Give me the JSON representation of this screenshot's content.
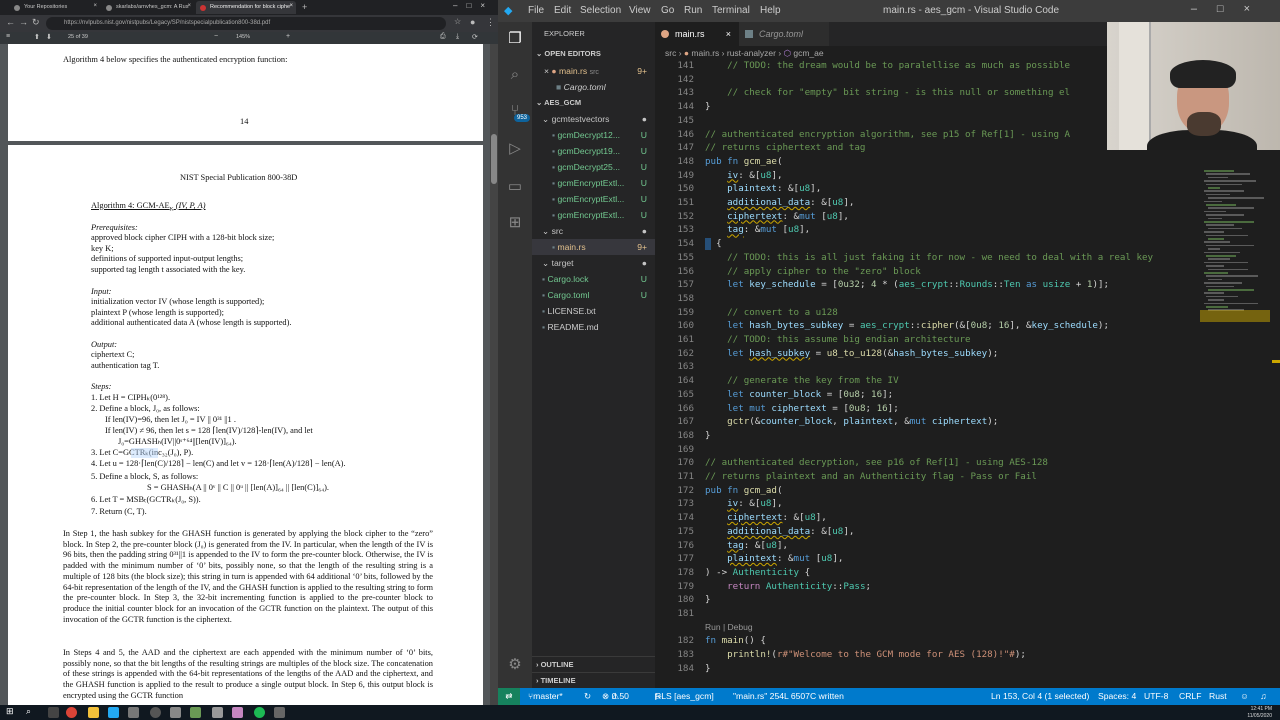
{
  "browser": {
    "tabs": [
      {
        "label": "Your Repositories",
        "active": false
      },
      {
        "label": "skarlabs/arnvhes_gcm: A Rus",
        "active": false
      },
      {
        "label": "Recommendation for block ciphe",
        "active": true
      }
    ],
    "url_host": "nvlpubs.nist.gov",
    "url": "https://nvlpubs.nist.gov/nistpubs/Legacy/SP/nistspecialpublication800-38d.pdf",
    "page_indicator": "25 of 39",
    "zoom": "145%"
  },
  "pdf": {
    "page1_text": "Algorithm 4 below specifies the authenticated encryption function:",
    "page1_number": "14",
    "header": "NIST Special Publication 800-38D",
    "algo_title": "Algorithm 4:  GCM-AE",
    "algo_sub": "K",
    "algo_args": "(IV, P, A)",
    "prereq_label": "Prerequisites:",
    "prereqs": [
      "approved block cipher CIPH with a 128-bit block size;",
      "key K;",
      "definitions of supported input-output lengths;",
      "supported tag length t associated with the key."
    ],
    "input_label": "Input:",
    "inputs": [
      "initialization vector IV (whose length is supported);",
      "plaintext P (whose length is supported);",
      "additional authenticated data A (whose length is supported)."
    ],
    "output_label": "Output:",
    "outputs": [
      "ciphertext C;",
      "authentication tag T."
    ],
    "steps_label": "Steps:",
    "steps": [
      "1.  Let H = CIPHₖ(0¹²⁸).",
      "2.  Define a block, J₀, as follows:",
      "If len(IV)=96, then let J₀ = IV || 0³¹ ||1 .",
      "If len(IV) ≠ 96, then let s = 128 ⌈len(IV)/128⌉-len(IV), and let",
      "J₀=GHASHₕ(IV||0ˢ⁺⁶⁴||[len(IV)]₆₄).",
      "3.  Let C=GCTRₖ(inc₃₂(J₀), P).",
      "4.  Let u = 128·⌈len(C)/128⌉ − len(C) and let v = 128·⌈len(A)/128⌉ − len(A).",
      "5.  Define a block, S, as follows:",
      "S = GHASHₕ(A || 0ᵛ || C || 0ᵘ || [len(A)]₆₄ || [len(C)]₆₄).",
      "6.  Let T = MSBₜ(GCTRₖ(J₀, S)).",
      "7.  Return (C, T)."
    ],
    "para1": "In Step 1, the hash subkey for the GHASH function is generated by applying the block cipher to the “zero” block. In Step 2, the pre-counter block (J₀) is generated from the IV. In particular, when the length of the IV is 96 bits, then the padding string 0³¹||1 is appended to the IV to form the pre-counter block. Otherwise, the IV is padded with the minimum number of ‘0’ bits, possibly none, so that the length of the resulting string is a multiple of 128 bits (the block size); this string in turn is appended with 64 additional ‘0’ bits, followed by the 64-bit representation of the length of the IV, and the GHASH function is applied to the resulting string to form the pre-counter block. In Step 3, the 32-bit incrementing function is applied to the pre-counter block to produce the initial counter block for an invocation of the GCTR function on the plaintext. The output of this invocation of the GCTR function is the ciphertext.",
    "para2": "In Steps 4 and 5, the AAD and the ciphertext are each appended with the minimum number of ‘0’ bits, possibly none, so that the bit lengths of the resulting strings are multiples of the block size. The concatenation of these strings is appended with the 64-bit representations of the lengths of the AAD and the ciphertext, and the GHASH function is applied to the result to produce a single output block. In Step 6, this output block is encrypted using the GCTR function"
  },
  "vscode": {
    "menu": [
      "File",
      "Edit",
      "Selection",
      "View",
      "Go",
      "Run",
      "Terminal",
      "Help"
    ],
    "window_title": "main.rs - aes_gcm - Visual Studio Code",
    "explorer_label": "EXPLORER",
    "open_editors_label": "OPEN EDITORS",
    "open_editors": [
      {
        "name": "main.rs",
        "path": "src",
        "badge": "9+"
      },
      {
        "name": "Cargo.toml",
        "path": "",
        "badge": ""
      }
    ],
    "project_label": "AES_GCM",
    "tree": [
      {
        "name": "gcmtestvectors",
        "badge": "●",
        "indent": 1,
        "folder": true
      },
      {
        "name": "gcmDecrypt12...",
        "badge": "U",
        "indent": 2
      },
      {
        "name": "gcmDecrypt19...",
        "badge": "U",
        "indent": 2
      },
      {
        "name": "gcmDecrypt25...",
        "badge": "U",
        "indent": 2
      },
      {
        "name": "gcmEncryptExtl...",
        "badge": "U",
        "indent": 2
      },
      {
        "name": "gcmEncryptExtl...",
        "badge": "U",
        "indent": 2
      },
      {
        "name": "gcmEncryptExtl...",
        "badge": "U",
        "indent": 2
      },
      {
        "name": "src",
        "badge": "●",
        "indent": 1,
        "folder": true
      },
      {
        "name": "main.rs",
        "badge": "9+",
        "indent": 2,
        "selected": true
      },
      {
        "name": "target",
        "badge": "●",
        "indent": 1,
        "folder": true
      },
      {
        "name": "Cargo.lock",
        "badge": "U",
        "indent": 1
      },
      {
        "name": "Cargo.toml",
        "badge": "U",
        "indent": 1
      },
      {
        "name": "LICENSE.txt",
        "badge": "",
        "indent": 1
      },
      {
        "name": "README.md",
        "badge": "",
        "indent": 1
      }
    ],
    "outline_label": "OUTLINE",
    "timeline_label": "TIMELINE",
    "tabs": [
      {
        "name": "main.rs",
        "active": true,
        "close": "×"
      },
      {
        "name": "Cargo.toml",
        "active": false,
        "close": ""
      }
    ],
    "breadcrumb": [
      "src",
      "main.rs",
      "rust-analyzer",
      "gcm_ae"
    ],
    "status": {
      "branch": "master*",
      "errors": "0",
      "warnings": "50",
      "rls": "RLS [aes_gcm]",
      "message": "\"main.rs\" 254L 6507C written",
      "position": "Ln 153, Col 4 (1 selected)",
      "spaces": "Spaces: 4",
      "encoding": "UTF-8",
      "eol": "CRLF",
      "language": "Rust"
    },
    "activity_badge": "953"
  },
  "code_lines": [
    {
      "n": "141",
      "h": [
        [
          "    ",
          "t"
        ],
        [
          "// TODO: the dream would be to paralellise as much as possible",
          "c-com"
        ]
      ]
    },
    {
      "n": "142",
      "h": [
        [
          "",
          "t"
        ]
      ]
    },
    {
      "n": "143",
      "h": [
        [
          "    ",
          "t"
        ],
        [
          "// check for \"empty\" bit string - is this null or something el",
          "c-com"
        ]
      ]
    },
    {
      "n": "144",
      "h": [
        [
          "}",
          "t"
        ]
      ]
    },
    {
      "n": "145",
      "h": [
        [
          "",
          "t"
        ]
      ]
    },
    {
      "n": "146",
      "h": [
        [
          "// authenticated encryption algorithm, see p15 of Ref[1] - using A",
          "c-com"
        ]
      ]
    },
    {
      "n": "147",
      "h": [
        [
          "// returns ciphertext and tag",
          "c-com"
        ]
      ]
    },
    {
      "n": "148",
      "h": [
        [
          "pub fn ",
          "c-kw"
        ],
        [
          "gcm_ae",
          "c-fn"
        ],
        [
          "(",
          "t"
        ]
      ]
    },
    {
      "n": "149",
      "h": [
        [
          "    ",
          "t"
        ],
        [
          "iv",
          "c-var c-warn"
        ],
        [
          ": &[",
          "t"
        ],
        [
          "u8",
          "c-ty"
        ],
        [
          "],",
          "t"
        ]
      ]
    },
    {
      "n": "150",
      "h": [
        [
          "    ",
          "t"
        ],
        [
          "plaintext",
          "c-var"
        ],
        [
          ": &[",
          "t"
        ],
        [
          "u8",
          "c-ty"
        ],
        [
          "],",
          "t"
        ]
      ]
    },
    {
      "n": "151",
      "h": [
        [
          "    ",
          "t"
        ],
        [
          "additional_data",
          "c-var c-warn"
        ],
        [
          ": &[",
          "t"
        ],
        [
          "u8",
          "c-ty"
        ],
        [
          "],",
          "t"
        ]
      ]
    },
    {
      "n": "152",
      "h": [
        [
          "    ",
          "t"
        ],
        [
          "ciphertext",
          "c-var c-warn"
        ],
        [
          ": &",
          "t"
        ],
        [
          "mut",
          "c-kw"
        ],
        [
          " [",
          "t"
        ],
        [
          "u8",
          "c-ty"
        ],
        [
          "],",
          "t"
        ]
      ]
    },
    {
      "n": "153",
      "h": [
        [
          "    ",
          "t"
        ],
        [
          "tag",
          "c-var c-warn"
        ],
        [
          ": &",
          "t"
        ],
        [
          "mut",
          "c-kw"
        ],
        [
          " [",
          "t"
        ],
        [
          "u8",
          "c-ty"
        ],
        [
          "],",
          "t"
        ]
      ]
    },
    {
      "n": "154",
      "h": [
        [
          ") {",
          "t"
        ]
      ]
    },
    {
      "n": "155",
      "h": [
        [
          "    ",
          "t"
        ],
        [
          "// TODO: this is all just faking it for now - we need to deal with a real key",
          "c-com"
        ]
      ]
    },
    {
      "n": "156",
      "h": [
        [
          "    ",
          "t"
        ],
        [
          "// apply cipher to the \"zero\" block",
          "c-com"
        ]
      ]
    },
    {
      "n": "157",
      "h": [
        [
          "    ",
          "t"
        ],
        [
          "let ",
          "c-kw"
        ],
        [
          "key_schedule",
          "c-var"
        ],
        [
          " = [",
          "t"
        ],
        [
          "0u32",
          "c-num"
        ],
        [
          "; ",
          "t"
        ],
        [
          "4",
          "c-num"
        ],
        [
          " * (",
          "t"
        ],
        [
          "aes_crypt",
          "c-ty"
        ],
        [
          "::",
          "t"
        ],
        [
          "Rounds",
          "c-ty"
        ],
        [
          "::",
          "t"
        ],
        [
          "Ten",
          "c-ty"
        ],
        [
          " as ",
          "c-kw"
        ],
        [
          "usize",
          "c-ty"
        ],
        [
          " + ",
          "t"
        ],
        [
          "1",
          "c-num"
        ],
        [
          ")];",
          "t"
        ]
      ]
    },
    {
      "n": "158",
      "h": [
        [
          "",
          "t"
        ]
      ]
    },
    {
      "n": "159",
      "h": [
        [
          "    ",
          "t"
        ],
        [
          "// convert to a u128",
          "c-com"
        ]
      ]
    },
    {
      "n": "160",
      "h": [
        [
          "    ",
          "t"
        ],
        [
          "let ",
          "c-kw"
        ],
        [
          "hash_bytes_subkey",
          "c-var"
        ],
        [
          " = ",
          "t"
        ],
        [
          "aes_crypt",
          "c-ty"
        ],
        [
          "::",
          "t"
        ],
        [
          "cipher",
          "c-fn"
        ],
        [
          "(&[",
          "t"
        ],
        [
          "0u8",
          "c-num"
        ],
        [
          "; ",
          "t"
        ],
        [
          "16",
          "c-num"
        ],
        [
          "], &",
          "t"
        ],
        [
          "key_schedule",
          "c-var"
        ],
        [
          ");",
          "t"
        ]
      ]
    },
    {
      "n": "161",
      "h": [
        [
          "    ",
          "t"
        ],
        [
          "// TODO: this assume big endian architecture",
          "c-com"
        ]
      ]
    },
    {
      "n": "162",
      "h": [
        [
          "    ",
          "t"
        ],
        [
          "let ",
          "c-kw"
        ],
        [
          "hash_subkey",
          "c-var c-warn"
        ],
        [
          " = ",
          "t"
        ],
        [
          "u8_to_u128",
          "c-fn"
        ],
        [
          "(&",
          "t"
        ],
        [
          "hash_bytes_subkey",
          "c-var"
        ],
        [
          ");",
          "t"
        ]
      ]
    },
    {
      "n": "163",
      "h": [
        [
          "",
          "t"
        ]
      ]
    },
    {
      "n": "164",
      "h": [
        [
          "    ",
          "t"
        ],
        [
          "// generate the key from the IV",
          "c-com"
        ]
      ]
    },
    {
      "n": "165",
      "h": [
        [
          "    ",
          "t"
        ],
        [
          "let ",
          "c-kw"
        ],
        [
          "counter_block",
          "c-var"
        ],
        [
          " = [",
          "t"
        ],
        [
          "0u8",
          "c-num"
        ],
        [
          "; ",
          "t"
        ],
        [
          "16",
          "c-num"
        ],
        [
          "];",
          "t"
        ]
      ]
    },
    {
      "n": "166",
      "h": [
        [
          "    ",
          "t"
        ],
        [
          "let ",
          "c-kw"
        ],
        [
          "mut ",
          "c-kw"
        ],
        [
          "ciphertext",
          "c-var"
        ],
        [
          " = [",
          "t"
        ],
        [
          "0u8",
          "c-num"
        ],
        [
          "; ",
          "t"
        ],
        [
          "16",
          "c-num"
        ],
        [
          "];",
          "t"
        ]
      ]
    },
    {
      "n": "167",
      "h": [
        [
          "    ",
          "t"
        ],
        [
          "gctr",
          "c-fn"
        ],
        [
          "(&",
          "t"
        ],
        [
          "counter_block",
          "c-var"
        ],
        [
          ", ",
          "t"
        ],
        [
          "plaintext",
          "c-var"
        ],
        [
          ", &",
          "t"
        ],
        [
          "mut ",
          "c-kw"
        ],
        [
          "ciphertext",
          "c-var"
        ],
        [
          ");",
          "t"
        ]
      ]
    },
    {
      "n": "168",
      "h": [
        [
          "}",
          "t"
        ]
      ]
    },
    {
      "n": "169",
      "h": [
        [
          "",
          "t"
        ]
      ]
    },
    {
      "n": "170",
      "h": [
        [
          "// authenticated decryption, see p16 of Ref[1] - using AES-128",
          "c-com"
        ]
      ]
    },
    {
      "n": "171",
      "h": [
        [
          "// returns plaintext and an Authenticity flag - Pass or Fail",
          "c-com"
        ]
      ]
    },
    {
      "n": "172",
      "h": [
        [
          "pub fn ",
          "c-kw"
        ],
        [
          "gcm_ad",
          "c-fn"
        ],
        [
          "(",
          "t"
        ]
      ]
    },
    {
      "n": "173",
      "h": [
        [
          "    ",
          "t"
        ],
        [
          "iv",
          "c-var c-warn"
        ],
        [
          ": &[",
          "t"
        ],
        [
          "u8",
          "c-ty"
        ],
        [
          "],",
          "t"
        ]
      ]
    },
    {
      "n": "174",
      "h": [
        [
          "    ",
          "t"
        ],
        [
          "ciphertext",
          "c-var c-warn"
        ],
        [
          ": &[",
          "t"
        ],
        [
          "u8",
          "c-ty"
        ],
        [
          "],",
          "t"
        ]
      ]
    },
    {
      "n": "175",
      "h": [
        [
          "    ",
          "t"
        ],
        [
          "additional_data",
          "c-var c-warn"
        ],
        [
          ": &[",
          "t"
        ],
        [
          "u8",
          "c-ty"
        ],
        [
          "],",
          "t"
        ]
      ]
    },
    {
      "n": "176",
      "h": [
        [
          "    ",
          "t"
        ],
        [
          "tag",
          "c-var c-warn"
        ],
        [
          ": &[",
          "t"
        ],
        [
          "u8",
          "c-ty"
        ],
        [
          "],",
          "t"
        ]
      ]
    },
    {
      "n": "177",
      "h": [
        [
          "    ",
          "t"
        ],
        [
          "plaintext",
          "c-var c-warn"
        ],
        [
          ": &",
          "t"
        ],
        [
          "mut",
          "c-kw"
        ],
        [
          " [",
          "t"
        ],
        [
          "u8",
          "c-ty"
        ],
        [
          "],",
          "t"
        ]
      ]
    },
    {
      "n": "178",
      "h": [
        [
          ") -> ",
          "t"
        ],
        [
          "Authenticity",
          "c-ty"
        ],
        [
          " {",
          "t"
        ]
      ]
    },
    {
      "n": "179",
      "h": [
        [
          "    ",
          "t"
        ],
        [
          "return ",
          "c-ctl"
        ],
        [
          "Authenticity",
          "c-ty"
        ],
        [
          "::",
          "t"
        ],
        [
          "Pass",
          "c-ty"
        ],
        [
          ";",
          "t"
        ]
      ]
    },
    {
      "n": "180",
      "h": [
        [
          "}",
          "t"
        ]
      ]
    },
    {
      "n": "181",
      "h": [
        [
          "",
          "t"
        ]
      ]
    },
    {
      "n": "",
      "h": [
        [
          "Run | Debug",
          "c-lens"
        ]
      ]
    },
    {
      "n": "182",
      "h": [
        [
          "fn ",
          "c-kw"
        ],
        [
          "main",
          "c-fn"
        ],
        [
          "() {",
          "t"
        ]
      ]
    },
    {
      "n": "183",
      "h": [
        [
          "    ",
          "t"
        ],
        [
          "println!",
          "c-fn"
        ],
        [
          "(",
          "t"
        ],
        [
          "r#\"Welcome to the GCM mode for AES (128)!\"#",
          "c-str"
        ],
        [
          ");",
          "t"
        ]
      ]
    },
    {
      "n": "184",
      "h": [
        [
          "}",
          "t"
        ]
      ]
    }
  ],
  "taskbar": {
    "time": "12:41 PM",
    "date": "11/05/2020"
  }
}
